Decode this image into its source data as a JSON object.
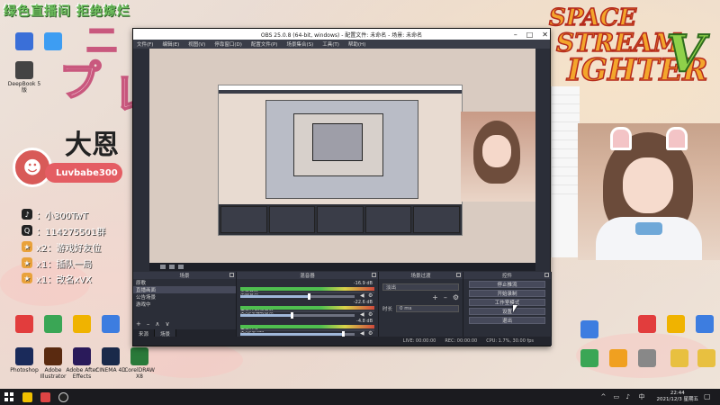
{
  "overlay": {
    "stream_title": "绿色直播间 拒绝嫁烂",
    "streamer_name": "Luvbabe300",
    "kanji": "大恩",
    "social": [
      {
        "icon": "tiktok-icon",
        "text": "：小300TwT"
      },
      {
        "icon": "qq-icon",
        "text": "：114275501群"
      },
      {
        "icon": "star-icon",
        "text": "x2：游戏好友位"
      },
      {
        "icon": "star-icon",
        "text": "x1：插队一局"
      },
      {
        "icon": "star-icon",
        "text": "x1：改名xVX"
      }
    ],
    "game_logo": {
      "line1": "SPACE",
      "line2": "STREAM",
      "line3": "IGHTER",
      "mark": "V"
    }
  },
  "desktop_icons_left": [
    {
      "label": "",
      "color": "#3a6fd8"
    },
    {
      "label": "",
      "color": "#3d9df2"
    },
    {
      "label": "DeepBook 5 版",
      "color": "#444"
    },
    {
      "label": "",
      "color": "#e23d3d"
    },
    {
      "label": "",
      "color": "#3aa655"
    },
    {
      "label": "",
      "color": "#f0b300"
    },
    {
      "label": "",
      "color": "#3d7de0"
    },
    {
      "label": "Photoshop",
      "color": "#1a2a5a"
    },
    {
      "label": "Adobe Illustrator",
      "color": "#5a2a10"
    },
    {
      "label": "Adobe After Effects",
      "color": "#2a1a5a"
    },
    {
      "label": "CINEMA 4D",
      "color": "#1a2a4a"
    },
    {
      "label": "CorelDRAW X8",
      "color": "#2a7a3a"
    }
  ],
  "desktop_icons_right": [
    {
      "label": "",
      "color": "#e23d3d"
    },
    {
      "label": "",
      "color": "#f0b300"
    },
    {
      "label": "",
      "color": "#3d7de0"
    },
    {
      "label": "",
      "color": "#3aa655"
    },
    {
      "label": "",
      "color": "#f0a020"
    },
    {
      "label": "",
      "color": "#888"
    },
    {
      "label": "",
      "color": "#e8c040"
    },
    {
      "label": "",
      "color": "#e8c040"
    },
    {
      "label": "",
      "color": "#3d7de0"
    }
  ],
  "obs": {
    "window_title": "OBS 25.0.8 (64-bit, windows) - 配置文件: 未命名 - 场景: 未命名",
    "menu": [
      "文件(F)",
      "编辑(E)",
      "视图(V)",
      "停靠窗口(D)",
      "配置文件(P)",
      "场景集合(S)",
      "工具(T)",
      "帮助(H)"
    ],
    "docks": {
      "scenes_title": "场景",
      "mixer_title": "混音器",
      "transitions_title": "场景过渡",
      "controls_title": "控件"
    },
    "scenes": [
      "原歌",
      "直播画面",
      "公告场景",
      "游戏中"
    ],
    "scene_tabs": [
      "来源",
      "场景"
    ],
    "mixer": [
      {
        "name": "桌面音频",
        "db": "-16.9 dB",
        "level": 0.6
      },
      {
        "name": "麦克风/辅助音频",
        "db": "-22.6 dB",
        "level": 0.45
      },
      {
        "name": "麦克风/Aux",
        "db": "-4.8 dB",
        "level": 0.9
      }
    ],
    "transitions": {
      "type": "淡出",
      "duration_label": "时长",
      "duration_value": "0 ms"
    },
    "controls": [
      "停止推流",
      "开始录制",
      "工作室模式",
      "设置",
      "退出"
    ],
    "status": [
      "LIVE: 00:00:00",
      "REC: 00:00:00",
      "CPU: 1.7%, 30.00 fps"
    ]
  },
  "taskbar": {
    "time": "22:44",
    "date": "2021/12/3 星期五"
  }
}
